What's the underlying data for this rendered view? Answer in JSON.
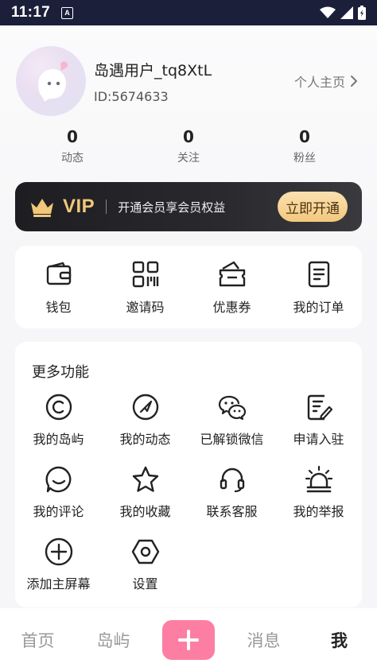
{
  "status_bar": {
    "time": "11:17",
    "notif_letter": "A"
  },
  "profile": {
    "username": "岛遇用户_tq8XtL",
    "user_id": "ID:5674633",
    "homepage_label": "个人主页"
  },
  "stats": [
    {
      "value": "0",
      "label": "动态"
    },
    {
      "value": "0",
      "label": "关注"
    },
    {
      "value": "0",
      "label": "粉丝"
    }
  ],
  "vip": {
    "title": "VIP",
    "description": "开通会员享会员权益",
    "button_label": "立即开通",
    "gold_color": "#f2c77a"
  },
  "quick_actions": [
    {
      "label": "钱包",
      "icon": "wallet-icon"
    },
    {
      "label": "邀请码",
      "icon": "qr-code-icon"
    },
    {
      "label": "优惠券",
      "icon": "coupon-icon"
    },
    {
      "label": "我的订单",
      "icon": "order-icon"
    }
  ],
  "more_functions": {
    "title": "更多功能",
    "items": [
      {
        "label": "我的岛屿",
        "icon": "island-icon"
      },
      {
        "label": "我的动态",
        "icon": "compass-icon"
      },
      {
        "label": "已解锁微信",
        "icon": "wechat-icon"
      },
      {
        "label": "申请入驻",
        "icon": "apply-edit-icon"
      },
      {
        "label": "我的评论",
        "icon": "comment-icon"
      },
      {
        "label": "我的收藏",
        "icon": "star-icon"
      },
      {
        "label": "联系客服",
        "icon": "headset-icon"
      },
      {
        "label": "我的举报",
        "icon": "alarm-icon"
      },
      {
        "label": "添加主屏幕",
        "icon": "add-circle-icon"
      },
      {
        "label": "设置",
        "icon": "settings-hexagon-icon"
      }
    ]
  },
  "bottom_nav": {
    "items": [
      "首页",
      "岛屿",
      "消息",
      "我"
    ],
    "active": "我",
    "plus_color": "#fd7ea3"
  }
}
